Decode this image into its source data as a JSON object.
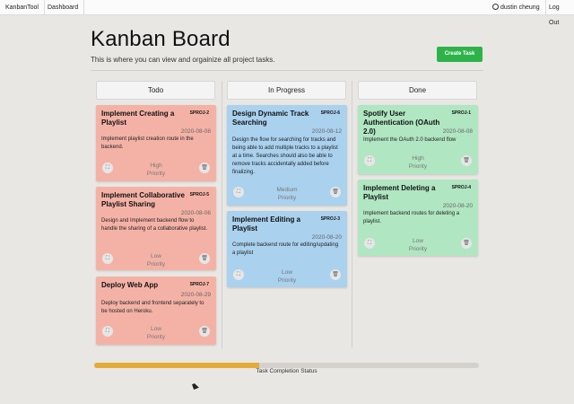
{
  "nav": {
    "brand": "KanbanTool",
    "dashboard": "Dashboard",
    "user": "dustin cheung",
    "logout": "Log Out"
  },
  "page": {
    "title": "Kanban Board",
    "subtitle": "This is where you can view and orgainize all project tasks.",
    "create_label": "Create Task"
  },
  "columns": [
    {
      "label": "Todo",
      "color": "#f4b2a6"
    },
    {
      "label": "In Progress",
      "color": "#aad1ee"
    },
    {
      "label": "Done",
      "color": "#b0e6c1"
    }
  ],
  "cards": {
    "todo": [
      {
        "title": "Implement Creating a Playlist",
        "id": "SPROJ-2",
        "date": "2020-08-08",
        "desc": "Implement playlist creation route in the backend.",
        "priority": "High",
        "priority_suffix": "Priority"
      },
      {
        "title": "Implement Collaborative Playlist Sharing",
        "id": "SPROJ-5",
        "date": "2020-08-06",
        "desc": "Design and Implement backend flow to handle the sharing of a collaborative playlist.",
        "priority": "Low",
        "priority_suffix": "Priority"
      },
      {
        "title": "Deploy Web App",
        "id": "SPROJ-7",
        "date": "2020-08-29",
        "desc": "Deploy backend and frontend separately to be hosted on Heroku.",
        "priority": "Low",
        "priority_suffix": "Priority"
      }
    ],
    "inprogress": [
      {
        "title": "Design Dynamic Track Searching",
        "id": "SPROJ-6",
        "date": "2020-08-12",
        "desc": "Design the flow for searching for tracks and being able to add multiple tracks to a playlist at a time. Searches should also be able to remove tracks accidentally added before finalizing.",
        "priority": "Medium",
        "priority_suffix": "Priority"
      },
      {
        "title": "Implement Editing a Playlist",
        "id": "SPROJ-3",
        "date": "2020-08-20",
        "desc": "Complete backend route for editing/updating a playlist",
        "priority": "Low",
        "priority_suffix": "Priority"
      }
    ],
    "done": [
      {
        "title": "Spotify User Authentication (OAuth 2.0)",
        "id": "SPROJ-1",
        "date": "2020-08-08",
        "desc": "Implement the OAuth 2.0 backend flow",
        "priority": "High",
        "priority_suffix": "Priority"
      },
      {
        "title": "Implement Deleting a Playlist",
        "id": "SPROJ-4",
        "date": "2020-08-20",
        "desc": "Implement backend routes for deleting a playlist.",
        "priority": "Low",
        "priority_suffix": "Priority"
      }
    ]
  },
  "progress": {
    "label": "Task Completion Status",
    "fraction": 0.43,
    "color": "#e3ac3a"
  },
  "icons": {
    "expand": "expand-icon",
    "delete": "trash-icon",
    "user": "user-circle-icon"
  }
}
